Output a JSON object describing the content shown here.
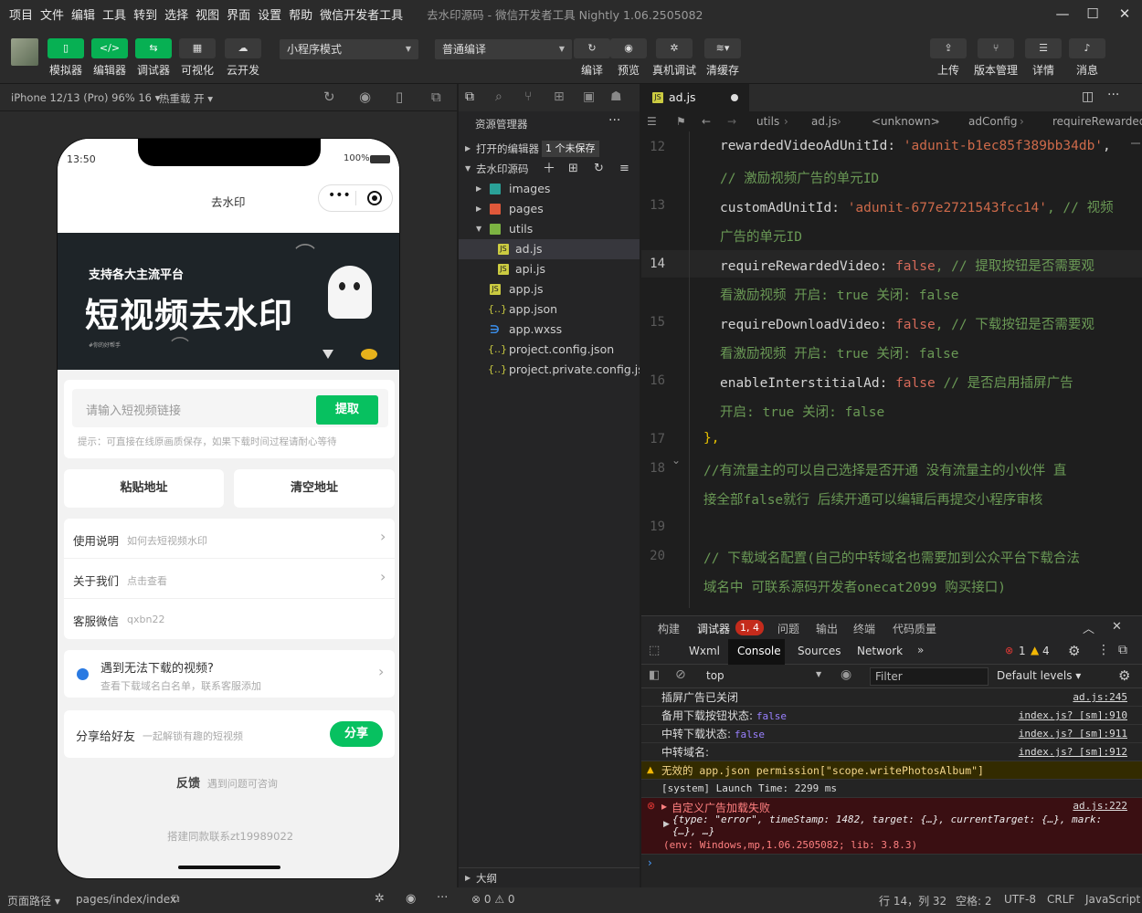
{
  "menu": [
    "项目",
    "文件",
    "编辑",
    "工具",
    "转到",
    "选择",
    "视图",
    "界面",
    "设置",
    "帮助",
    "微信开发者工具"
  ],
  "window_title": "去水印源码 - 微信开发者工具 Nightly 1.06.2505082",
  "toolbar": {
    "left_buttons": [
      "模拟器",
      "编辑器",
      "调试器",
      "可视化",
      "云开发"
    ],
    "mode_select": "小程序模式",
    "compile_select": "普通编译",
    "mid_buttons": [
      "编译",
      "预览",
      "真机调试",
      "清缓存"
    ],
    "right_buttons": [
      "上传",
      "版本管理",
      "详情",
      "消息"
    ]
  },
  "simulator": {
    "device": "iPhone 12/13 (Pro) 96% 16",
    "hot_reload": "热重载 开"
  },
  "phone": {
    "time": "13:50",
    "battery": "100%",
    "nav_title": "去水印",
    "banner_top": "支持各大主流平台",
    "banner_main": "短视频去水印",
    "banner_small": "#你的好帮手",
    "input_placeholder": "请输入短视频链接",
    "extract_btn": "提取",
    "hint": "提示：可直接在线原画质保存，如果下载时间过程请耐心等待",
    "paste_btn": "粘贴地址",
    "clear_btn": "清空地址",
    "menu_items": [
      {
        "title": "使用说明",
        "sub": "如何去短视频水印"
      },
      {
        "title": "关于我们",
        "sub": "点击查看"
      },
      {
        "title": "客服微信",
        "sub": "qxbn22"
      }
    ],
    "notice_title": "遇到无法下载的视频?",
    "notice_sub": "查看下载域名白名单，联系客服添加",
    "share_title": "分享给好友",
    "share_sub": "一起解锁有趣的短视频",
    "share_btn": "分享",
    "feedback_title": "反馈",
    "feedback_sub": "遇到问题可咨询",
    "footer": "搭建同款联系zt19989022"
  },
  "explorer": {
    "title": "资源管理器",
    "open_editors": "打开的编辑器",
    "unsaved_badge": "1 个未保存",
    "project": "去水印源码",
    "tree": [
      "images",
      "pages",
      "utils",
      "ad.js",
      "api.js",
      "app.js",
      "app.json",
      "app.wxss",
      "project.config.json",
      "project.private.config.js..."
    ],
    "outline": "大纲"
  },
  "editor": {
    "tab": "ad.js",
    "breadcrumb": [
      "utils",
      "ad.js",
      "<unknown>",
      "adConfig",
      "requireRewarded"
    ],
    "line_numbers": [
      "12",
      "13",
      "14",
      "15",
      "16",
      "17",
      "18",
      "19",
      "20"
    ],
    "lines": {
      "l1_key": "rewardedVideoAdUnitId: ",
      "l1_str": "'adunit-b1ec85f389bb34db'",
      "l1_end": ",",
      "l2": "// 激励视频广告的单元ID",
      "l3_key": "customAdUnitId: ",
      "l3_str": "'adunit-677e2721543fcc14'",
      "l3_cm": ", // 视频",
      "l4": "广告的单元ID",
      "l5_key": "requireRewardedVideo: ",
      "l5_kw": "false",
      "l5_cm": ", // 提取按钮是否需要观",
      "l6": "看激励视频   开启: true  关闭: false",
      "l7_key": "requireDownloadVideo: ",
      "l7_kw": "false",
      "l7_cm": ", // 下载按钮是否需要观",
      "l8": "看激励视频   开启: true  关闭: false",
      "l9_key": "enableInterstitialAd: ",
      "l9_kw": "false",
      "l9_cm": " // 是否启用插屏广告",
      "l10": "开启: true  关闭: false",
      "l11": "},",
      "l12": "//有流量主的可以自己选择是否开通  没有流量主的小伙伴 直",
      "l13": "接全部false就行  后续开通可以编辑后再提交小程序审核",
      "l14": "// 下载域名配置(自己的中转域名也需要加到公众平台下载合法",
      "l15": "域名中 可联系源码开发者onecat2099 购买接口)"
    }
  },
  "devtools": {
    "panel_tabs": [
      "构建",
      "调试器",
      "问题",
      "输出",
      "终端",
      "代码质量"
    ],
    "debug_badge": "1, 4",
    "inner_tabs": [
      "Wxml",
      "Console",
      "Sources",
      "Network"
    ],
    "errors": "1",
    "warnings": "4",
    "context": "top",
    "filter_placeholder": "Filter",
    "levels": "Default levels"
  },
  "console": [
    {
      "text": "插屏广告已关闭",
      "src": "ad.js:245"
    },
    {
      "text": "备用下载按钮状态: ",
      "val": "false",
      "src": "index.js? [sm]:910"
    },
    {
      "text": "中转下载状态: ",
      "val": "false",
      "src": "index.js? [sm]:911"
    },
    {
      "text": "中转域名:",
      "src": "index.js? [sm]:912"
    }
  ],
  "console_warn": "无效的 app.json permission[\"scope.writePhotosAlbum\"]",
  "console_launch": "[system] Launch Time: 2299 ms",
  "console_error": {
    "title": "自定义广告加载失败",
    "src": "ad.js:222",
    "detail1": "{type: \"error\", timeStamp: 1482, target: {…}, currentTarget: {…}, mark:",
    "detail2": "{…}, …}",
    "env": "(env: Windows,mp,1.06.2505082; lib: 3.8.3)"
  },
  "statusbar": {
    "page_path_label": "页面路径",
    "page_path": "pages/index/index",
    "problems": "⊗ 0 ⚠ 0",
    "cursor": "行 14，列 32",
    "spaces": "空格: 2",
    "encoding": "UTF-8",
    "eol": "CRLF",
    "language": "JavaScript"
  }
}
